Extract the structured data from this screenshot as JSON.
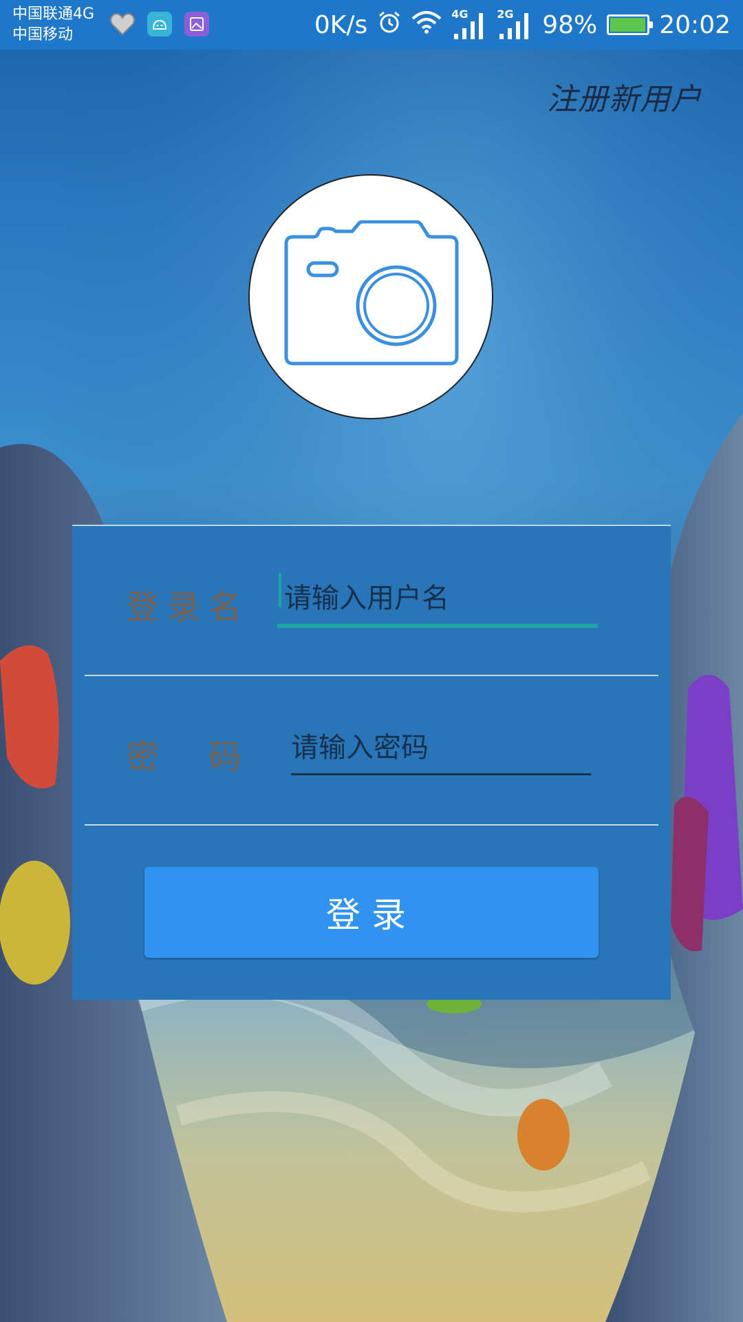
{
  "status_bar": {
    "carrier_1": "中国联通4G",
    "carrier_2": "中国移动",
    "net_speed": "0K/s",
    "signal_1_type": "4G",
    "signal_2_type": "2G",
    "battery_percent": "98%",
    "battery_level": 0.98,
    "time": "20:02",
    "icons": [
      "heart-app-icon",
      "android-icon",
      "gallery-icon",
      "alarm-icon",
      "wifi-icon",
      "signal-icon",
      "signal-icon",
      "battery-charging-icon"
    ]
  },
  "register_link": "注册新用户",
  "avatar": {
    "icon": "camera-icon",
    "color": "#3a8fe0"
  },
  "form": {
    "username_label": "登录名",
    "username_placeholder": "请输入用户名",
    "password_label": "密　码",
    "password_placeholder": "请输入密码",
    "login_button": "登录"
  },
  "colors": {
    "status_bar": "#1e77c9",
    "card": "#2875b8",
    "button": "#3193f0",
    "focus_underline": "#1ca6a2",
    "label": "#7a6250"
  }
}
